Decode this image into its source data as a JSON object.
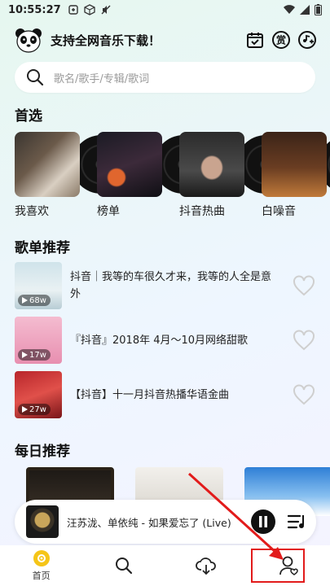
{
  "status_bar": {
    "time": "10:55:27"
  },
  "header": {
    "title": "支持全网音乐下载！"
  },
  "search": {
    "placeholder": "歌名/歌手/专辑/歌词"
  },
  "featured": {
    "title": "首选",
    "items": [
      {
        "label": "我喜欢"
      },
      {
        "label": "榜单"
      },
      {
        "label": "抖音热曲"
      },
      {
        "label": "白噪音"
      }
    ]
  },
  "playlists": {
    "title": "歌单推荐",
    "items": [
      {
        "title": "抖音｜我等的车很久才来，我等的人全是意外",
        "plays": "68w"
      },
      {
        "title": "『抖音』2018年 4月～10月网络甜歌",
        "plays": "17w"
      },
      {
        "title": "【抖音】十一月抖音热播华语金曲",
        "plays": "27w"
      }
    ]
  },
  "daily": {
    "title": "每日推荐"
  },
  "player": {
    "now_playing": "汪苏泷、单依纯 - 如果爱忘了 (Live)"
  },
  "tabs": [
    {
      "label": "首页",
      "icon": "home-icon",
      "active": true
    },
    {
      "label": "",
      "icon": "search-icon"
    },
    {
      "label": "",
      "icon": "download-icon"
    },
    {
      "label": "",
      "icon": "profile-icon"
    }
  ],
  "colors": {
    "annotation_red": "#e21b1b",
    "active_tab": "#f5c518"
  }
}
